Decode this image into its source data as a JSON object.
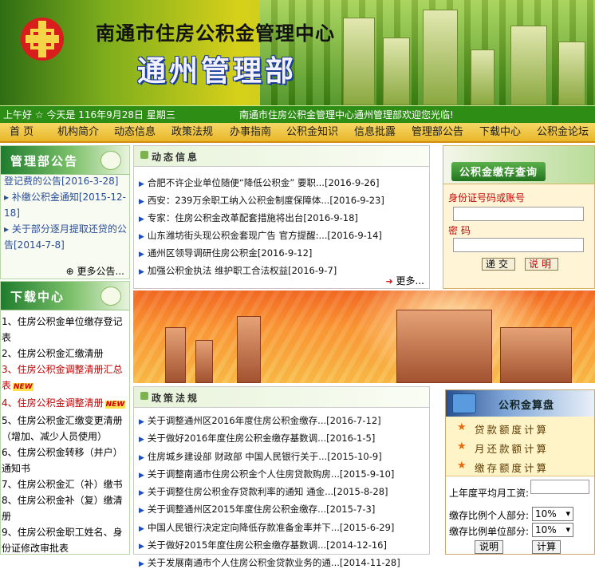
{
  "header": {
    "title": "南通市住房公积金管理中心",
    "subtitle": "通州管理部"
  },
  "status": {
    "greeting": "上午好 ☆ 今天是 116年9月28日 星期三",
    "welcome": "南通市住房公积金管理中心通州管理部欢迎您光临!"
  },
  "nav": [
    "首 页",
    "机构简介",
    "动态信息",
    "政策法规",
    "办事指南",
    "公积金知识",
    "信息批露",
    "管理部公告",
    "下载中心",
    "公积金论坛"
  ],
  "notice": {
    "title": "管理部公告",
    "items": [
      "登记费的公告[2016-3-28]",
      "补缴公积金通知[2015-12-18]",
      "关于部分逐月提取还贷的公告[2014-7-8]"
    ],
    "more": "更多公告..."
  },
  "download": {
    "title": "下载中心",
    "items": [
      {
        "text": "1、住房公积金单位缴存登记表",
        "color": "#000000",
        "new": false
      },
      {
        "text": "2、住房公积金汇缴清册",
        "color": "#000000",
        "new": false
      },
      {
        "text": "3、住房公积金调整清册汇总表",
        "color": "#c00000",
        "new": true
      },
      {
        "text": "4、住房公积金调整清册",
        "color": "#c00000",
        "new": true
      },
      {
        "text": "5、住房公积金汇缴变更清册（增加、减少人员使用）",
        "color": "#000000",
        "new": false
      },
      {
        "text": "6、住房公积金转移（并户）通知书",
        "color": "#000000",
        "new": false
      },
      {
        "text": "7、住房公积金汇（补）缴书",
        "color": "#000000",
        "new": false
      },
      {
        "text": "8、住房公积金补（复）缴清册",
        "color": "#000000",
        "new": false
      },
      {
        "text": "9、住房公积金职工姓名、身份证修改审批表",
        "color": "#000000",
        "new": false
      }
    ],
    "new_label": "NEW"
  },
  "dongtai": {
    "title": "动态信息",
    "items": [
      {
        "text": "合肥不许企业单位随便“降低公积金” 要职...",
        "date": "[2016-9-26]"
      },
      {
        "text": "西安：239万余职工纳入公积金制度保障体...",
        "date": "[2016-9-23]"
      },
      {
        "text": "专家：住房公积金改革配套措施将出台",
        "date": "[2016-9-18]"
      },
      {
        "text": "山东潍坊街头现公积金套现广告 官方提醒:...",
        "date": "[2016-9-14]"
      },
      {
        "text": "通州区领导调研住房公积金",
        "date": "[2016-9-12]"
      },
      {
        "text": "加强公积金执法 维护职工合法权益",
        "date": "[2016-9-7]"
      }
    ],
    "more": "更多..."
  },
  "zhengce": {
    "title": "政策法规",
    "items": [
      {
        "text": "关于调整通州区2016年度住房公积金缴存...",
        "date": "[2016-7-12]"
      },
      {
        "text": "关于做好2016年度住房公积金缴存基数调...",
        "date": "[2016-1-5]"
      },
      {
        "text": "住房城乡建设部 财政部 中国人民银行关于...",
        "date": "[2015-10-9]"
      },
      {
        "text": "关于调整南通市住房公积金个人住房贷款购房...",
        "date": "[2015-9-10]"
      },
      {
        "text": "关于调整住房公积金存贷款利率的通知 通金...",
        "date": "[2015-8-28]"
      },
      {
        "text": "关于调整通州区2015年度住房公积金缴存...",
        "date": "[2015-7-3]"
      },
      {
        "text": "中国人民银行决定定向降低存款准备金率并下...",
        "date": "[2015-6-29]"
      },
      {
        "text": "关于做好2015年度住房公积金缴存基数调...",
        "date": "[2014-12-16]"
      },
      {
        "text": "关于发展南通市个人住房公积金贷款业务的通...",
        "date": "[2014-11-28]"
      }
    ]
  },
  "query": {
    "title": "公积金缴存查询",
    "id_label": "身份证号码或账号",
    "pwd_label": "密 码",
    "submit": "递交",
    "help": "说明"
  },
  "calc": {
    "title": "公积金算盘",
    "menu": [
      "贷款额度计算",
      "月还款额计算",
      "缴存额度计算"
    ],
    "avg_label": "上年度平均月工资:",
    "personal_label": "缴存比例个人部分:",
    "personal_value": "10%",
    "unit_label": "缴存比例单位部分:",
    "unit_value": "10%",
    "help": "说明",
    "calc_button": "计算"
  }
}
